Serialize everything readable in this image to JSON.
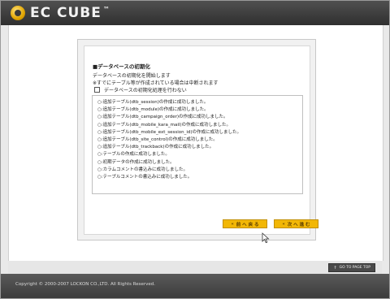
{
  "header": {
    "logo_text": "EC CUBE",
    "logo_tm": "™"
  },
  "main": {
    "section_title": "■データベースの初期化",
    "description_1": "データベースの初期化を開始します",
    "description_2": "※すでにテーブル等が作成されている場合は中断されます",
    "checkbox_label": "データベースの初期化処理を行わない",
    "checkbox_checked": false,
    "log_items": [
      "○:追加テーブル(dtb_session)の作成に成功しました。",
      "○:追加テーブル(dtb_module)の作成に成功しました。",
      "○:追加テーブル(dtb_campaign_order)の作成に成功しました。",
      "○:追加テーブル(dtb_mobile_kara_mail)の作成に成功しました。",
      "○:追加テーブル(dtb_mobile_ext_session_id)の作成に成功しました。",
      "○:追加テーブル(dtb_site_control)の作成に成功しました。",
      "○:追加テーブル(dtb_trackback)の作成に成功しました。",
      "○:テーブルの作成に成功しました。",
      "○:初期データの作成に成功しました。",
      "○:カラムコメントの書込みに成功しました。",
      "○:テーブルコメントの書込みに成功しました。"
    ]
  },
  "buttons": {
    "prev_label": "前 へ 戻 る",
    "next_label": "次 へ 進 む",
    "arrow_glyph": "«"
  },
  "footer": {
    "go_to_top_label": "GO TO PAGE TOP",
    "copyright": "Copyright © 2000-2007 LOCKON CO.,LTD. All Rights Reserved."
  },
  "colors": {
    "header_bg": "#3a3a3a",
    "button_accent": "#f2b705",
    "footer_bg": "#4a4a4a"
  }
}
